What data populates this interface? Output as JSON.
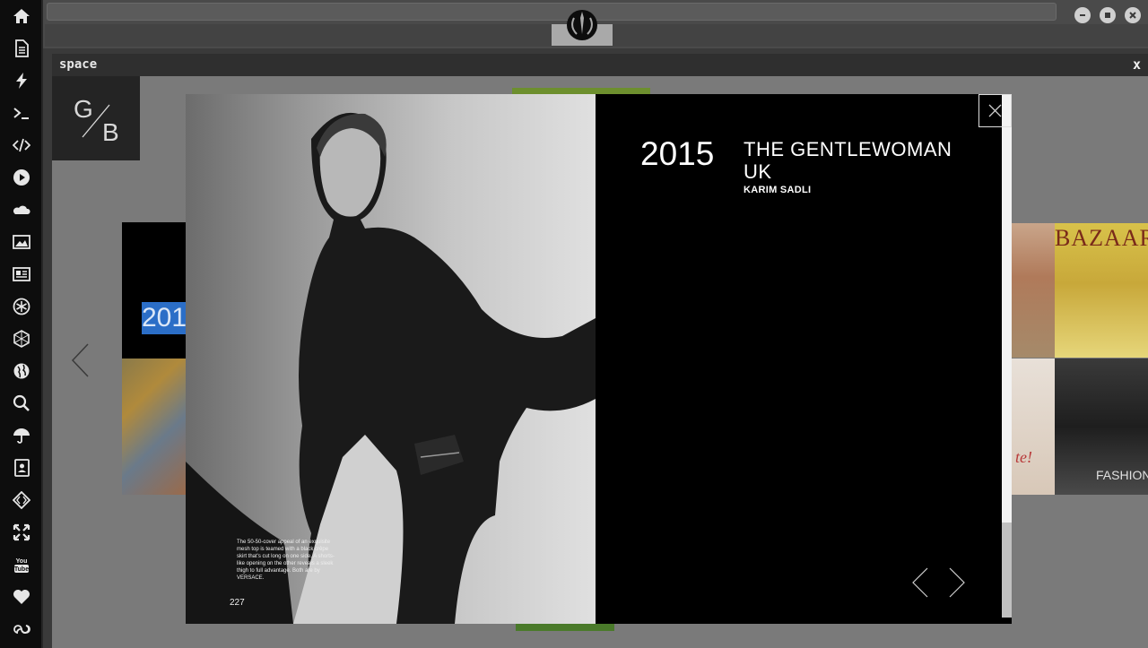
{
  "dock": {
    "items": [
      {
        "name": "home-icon"
      },
      {
        "name": "document-icon"
      },
      {
        "name": "lightning-icon"
      },
      {
        "name": "terminal-icon"
      },
      {
        "name": "code-icon"
      },
      {
        "name": "play-icon"
      },
      {
        "name": "cloud-icon"
      },
      {
        "name": "image-icon"
      },
      {
        "name": "newspaper-icon"
      },
      {
        "name": "rebel-badge-icon"
      },
      {
        "name": "hexagon-icon"
      },
      {
        "name": "globe-icon"
      },
      {
        "name": "search-icon"
      },
      {
        "name": "umbrella-icon"
      },
      {
        "name": "contacts-icon"
      },
      {
        "name": "diamond-code-icon"
      },
      {
        "name": "expand-icon"
      },
      {
        "name": "youtube-icon"
      },
      {
        "name": "heart-icon"
      },
      {
        "name": "infinity-cloud-icon"
      }
    ]
  },
  "topbar": {
    "logo_icon": "rebel-alliance-icon",
    "window_controls": [
      "minimize-icon",
      "maximize-icon",
      "close-icon"
    ]
  },
  "frame": {
    "title": "space",
    "close_label": "x"
  },
  "gallery": {
    "year_partial": "201",
    "magazine_1_title": "BAZAAR",
    "magazine_3_title": "te!",
    "magazine_4_title": "FASHION ISSU"
  },
  "lightbox": {
    "year": "2015",
    "publication": "THE GENTLEWOMAN UK",
    "photographer": "KARIM SADLI",
    "caption": "The 50-50-cover appeal of an exquisite mesh top is teamed with a black crêpe skirt that's cut long on one side. A shorts-like opening on the other reveals a sleek thigh to full advantage. Both are by VERSACE.",
    "page_number": "227"
  },
  "colors": {
    "highlight": "#2b6ec7",
    "lightbox_bg": "#000000",
    "dock_bg": "#0d0d0d"
  }
}
